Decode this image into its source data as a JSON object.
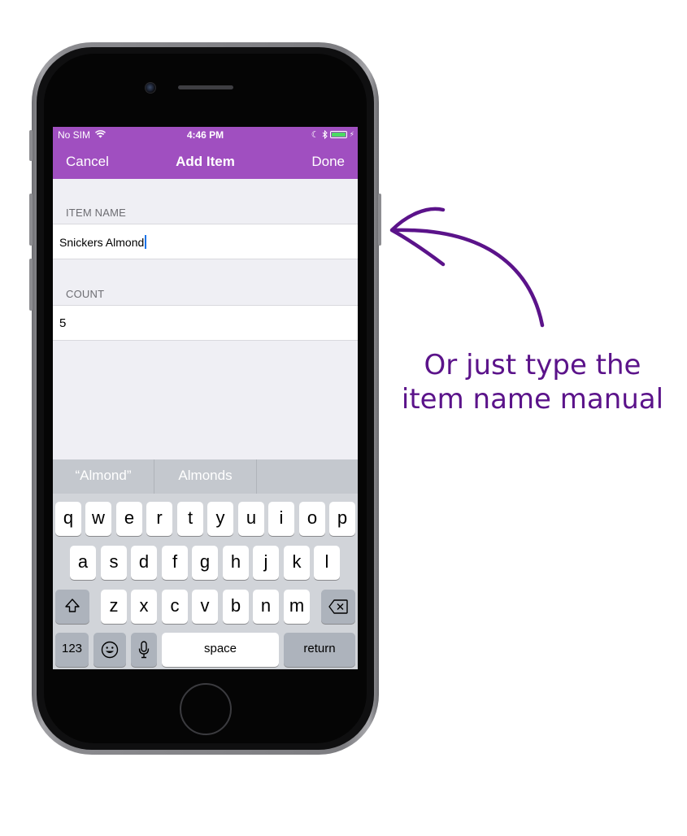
{
  "status_bar": {
    "carrier": "No SIM",
    "time": "4:46 PM"
  },
  "nav": {
    "cancel": "Cancel",
    "title": "Add Item",
    "done": "Done"
  },
  "form": {
    "item_name_header": "ITEM NAME",
    "item_name_value": "Snickers Almond",
    "count_header": "COUNT",
    "count_value": "5"
  },
  "keyboard": {
    "suggestions": [
      "“Almond”",
      "Almonds",
      ""
    ],
    "row1": [
      "q",
      "w",
      "e",
      "r",
      "t",
      "y",
      "u",
      "i",
      "o",
      "p"
    ],
    "row2": [
      "a",
      "s",
      "d",
      "f",
      "g",
      "h",
      "j",
      "k",
      "l"
    ],
    "row3": [
      "z",
      "x",
      "c",
      "v",
      "b",
      "n",
      "m"
    ],
    "numbers_key": "123",
    "space_key": "space",
    "return_key": "return"
  },
  "annotation": {
    "line1": "Or just type the",
    "line2": "item name manual"
  },
  "colors": {
    "nav": "#a04fc0",
    "annotation": "#5b138a",
    "caret": "#1a73e8"
  }
}
